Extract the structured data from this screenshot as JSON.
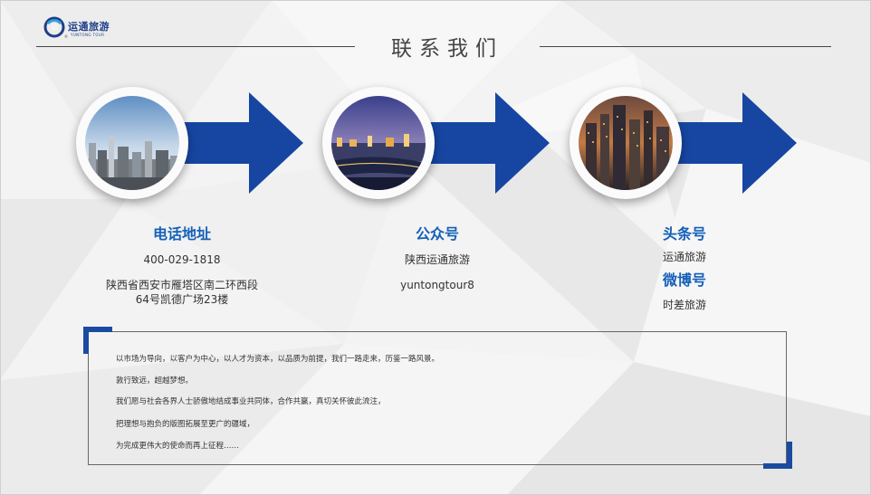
{
  "logo": {
    "name_cn": "运通旅游",
    "name_en": "YUNTONG TOUR",
    "mark": "®",
    "icon": "ring-logo-icon",
    "color": "#1f3f88"
  },
  "title": "联系我们",
  "accent_color": "#1560b8",
  "arrow_color": "#1746a2",
  "photos": [
    {
      "icon": "city-skyline-photo"
    },
    {
      "icon": "night-river-city-photo"
    },
    {
      "icon": "night-skyscrapers-photo"
    }
  ],
  "contacts": {
    "phone": {
      "heading": "电话地址",
      "number": "400-029-1818",
      "address_line1": "陕西省西安市雁塔区南二环西段",
      "address_line2": "64号凯德广场23楼"
    },
    "wechat": {
      "heading": "公众号",
      "name": "陕西运通旅游",
      "id": "yuntongtour8"
    },
    "toutiao": {
      "heading": "头条号",
      "name": "运通旅游"
    },
    "weibo": {
      "heading": "微博号",
      "name": "时差旅游"
    }
  },
  "quote": [
    "以市场为导向，以客户为中心，以人才为资本，以品质为前提，我们一路走来，历鉴一路风景。",
    "敦行致远，超越梦想。",
    "我们愿与社会各界人士骄傲地结成事业共同体，合作共赢，真切关怀彼此流注，",
    "把理想与抱负的版图拓展至更广的疆域，",
    "为完成更伟大的使命而再上征程……"
  ]
}
